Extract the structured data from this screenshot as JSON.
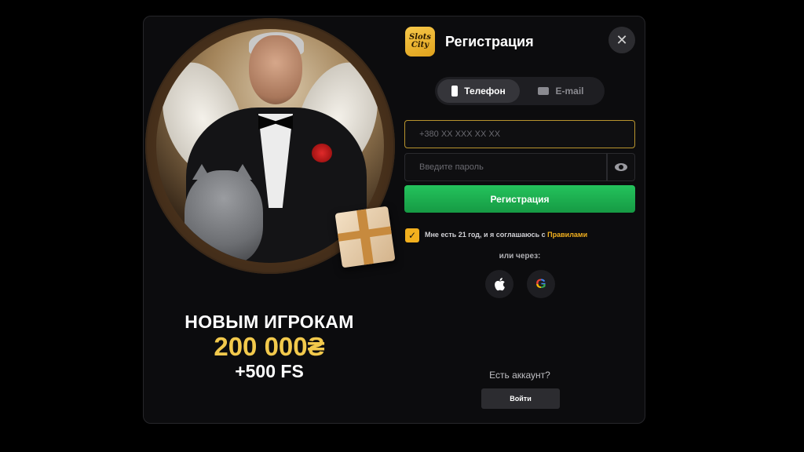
{
  "promo": {
    "line1": "НОВЫМ ИГРОКАМ",
    "amount": "200 000₴",
    "bonus": "+500 FS"
  },
  "header": {
    "logo_text": "Slots City",
    "title": "Регистрация",
    "close_icon": "close-icon"
  },
  "tabs": [
    {
      "label": "Телефон",
      "icon": "phone-icon",
      "active": true
    },
    {
      "label": "E-mail",
      "icon": "mail-icon",
      "active": false
    }
  ],
  "fields": {
    "phone_placeholder": "+380 XX XXX XX XX",
    "password_placeholder": "Введите пароль"
  },
  "register_button": "Регистрация",
  "agreement": {
    "text": "Мне есть 21 год, и я соглашаюсь с ",
    "link": "Правилами",
    "checked": true
  },
  "or_via": "или через:",
  "social": [
    "apple-icon",
    "google-icon"
  ],
  "login": {
    "prompt": "Есть аккаунт?",
    "button": "Войти"
  },
  "colors": {
    "accent": "#f2b01e",
    "register": "#1fb553",
    "amount": "#f2c94c"
  }
}
